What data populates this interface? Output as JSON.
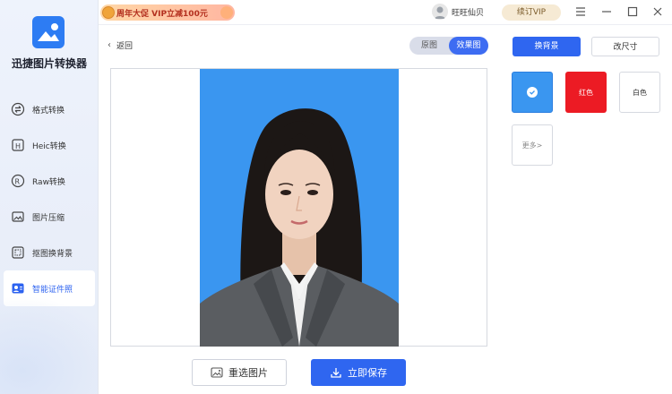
{
  "app": {
    "name": "迅捷图片转换器"
  },
  "sidebar": {
    "items": [
      {
        "label": "格式转换",
        "icon": "format-convert-icon"
      },
      {
        "label": "Heic转换",
        "icon": "heic-icon"
      },
      {
        "label": "Raw转换",
        "icon": "raw-icon"
      },
      {
        "label": "图片压缩",
        "icon": "image-compress-icon"
      },
      {
        "label": "抠图换背景",
        "icon": "cutout-icon"
      },
      {
        "label": "智能证件照",
        "icon": "id-photo-icon",
        "active": true
      }
    ]
  },
  "topbar": {
    "promo": "周年大促 VIP立减100元",
    "username": "旺旺仙贝",
    "renew_label": "续订VIP",
    "window_controls": [
      "menu-icon",
      "minimize-icon",
      "maximize-icon",
      "close-icon"
    ]
  },
  "preview": {
    "back_label": "返回",
    "toggle": {
      "original": "原图",
      "result": "效果图",
      "selected": "效果图"
    },
    "reselect_label": "重选图片",
    "save_label": "立即保存"
  },
  "right_panel": {
    "tabs": {
      "change_bg": "换背景",
      "resize": "改尺寸",
      "selected": "换背景"
    },
    "colors": [
      {
        "label": "",
        "hex": "#3a96f0",
        "selected": true
      },
      {
        "label": "红色",
        "hex": "#ec1b24"
      },
      {
        "label": "白色",
        "hex": "#ffffff"
      }
    ],
    "more_label": "更多>"
  },
  "colors": {
    "accent": "#2f66f0",
    "photo_bg": "#3a96f0"
  }
}
